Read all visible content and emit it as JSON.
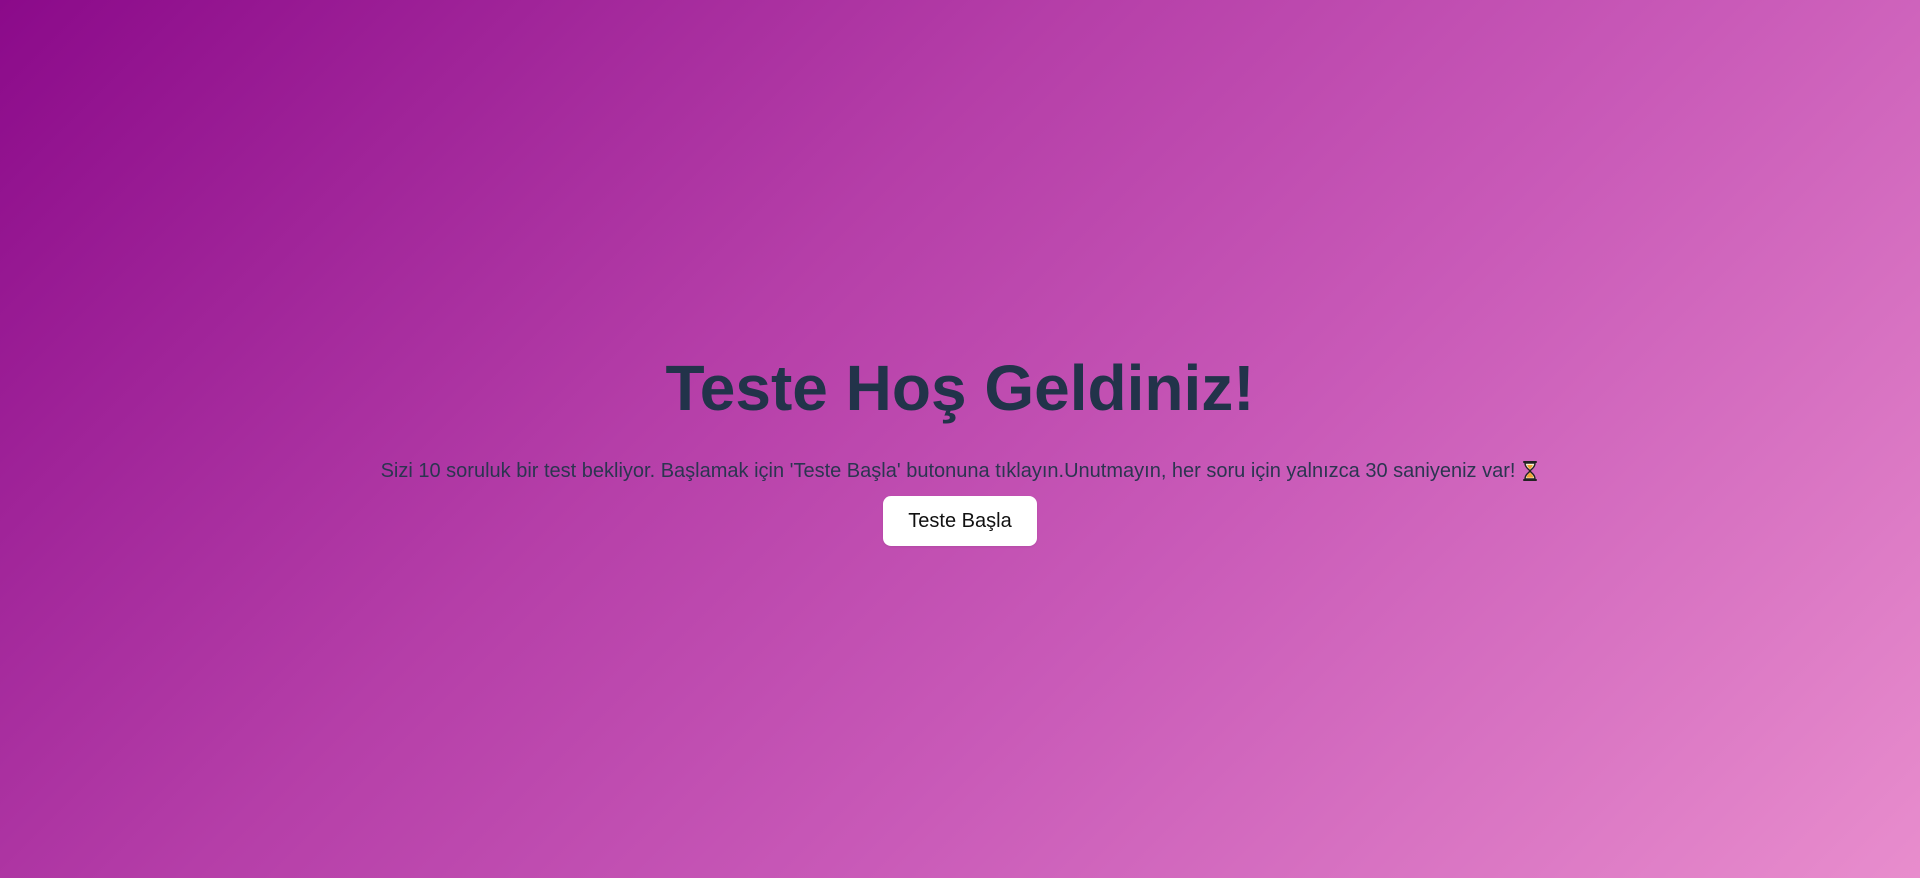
{
  "page": {
    "title": "Teste Hoş Geldiniz!",
    "description": "Sizi 10 soruluk bir test bekliyor. Başlamak için 'Teste Başla' butonuna tıklayın.Unutmayın, her soru için yalnızca 30 saniyeniz var!",
    "description_icon": "hourglass-icon",
    "start_button_label": "Teste Başla"
  },
  "colors": {
    "gradient_start": "#8b0a8a",
    "gradient_end": "#e88dcd",
    "title_text": "#22334a",
    "button_bg": "#ffffff"
  }
}
